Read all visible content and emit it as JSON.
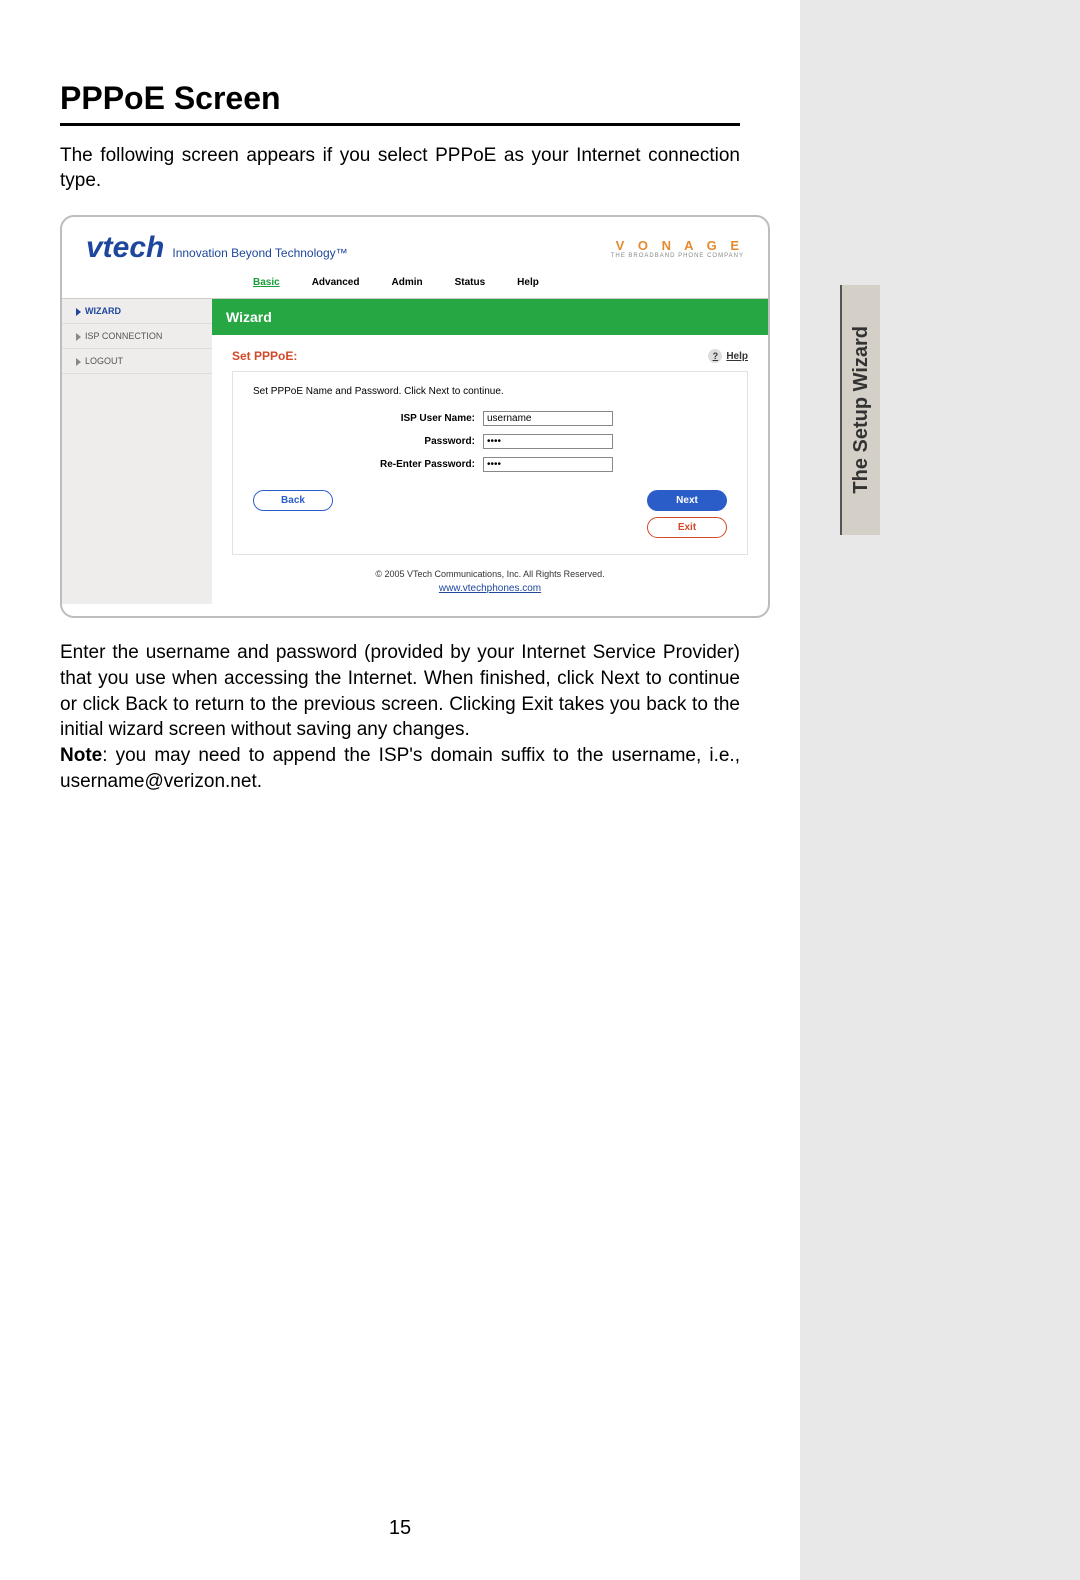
{
  "doc": {
    "title": "PPPoE Screen",
    "intro": "The following screen appears if you select PPPoE as your Internet connection type.",
    "after_para": "Enter the username and password (provided by your Internet Service Provider) that you use when accessing the Internet. When finished, click Next to continue or click Back to return to the previous screen. Clicking Exit takes you back to the initial wizard screen without saving any changes.",
    "note_label": "Note",
    "note_text": ": you may need to append the ISP's domain suffix to the username, i.e., username@verizon.net.",
    "page_number": "15",
    "side_tab": "The Setup Wizard"
  },
  "ui": {
    "brand": {
      "logo": "vtech",
      "tagline": "Innovation Beyond Technology™",
      "vonage": "V O N A G E",
      "vonage_sub": "THE BROADBAND PHONE COMPANY"
    },
    "topnav": {
      "items": [
        "Basic",
        "Advanced",
        "Admin",
        "Status",
        "Help"
      ],
      "active_index": 0
    },
    "sidebar": {
      "items": [
        "WIZARD",
        "ISP CONNECTION",
        "LOGOUT"
      ],
      "active_index": 0
    },
    "wizard": {
      "header": "Wizard",
      "section_title": "Set PPPoE:",
      "help_label": "Help",
      "instruction": "Set PPPoE Name and Password. Click Next to continue.",
      "fields": {
        "username_label": "ISP User Name:",
        "username_value": "username",
        "password_label": "Password:",
        "password_value": "••••",
        "repassword_label": "Re-Enter Password:",
        "repassword_value": "••••"
      },
      "buttons": {
        "back": "Back",
        "next": "Next",
        "exit": "Exit"
      }
    },
    "footer": {
      "copyright": "© 2005 VTech Communications, Inc. All Rights Reserved.",
      "link": "www.vtechphones.com"
    }
  }
}
